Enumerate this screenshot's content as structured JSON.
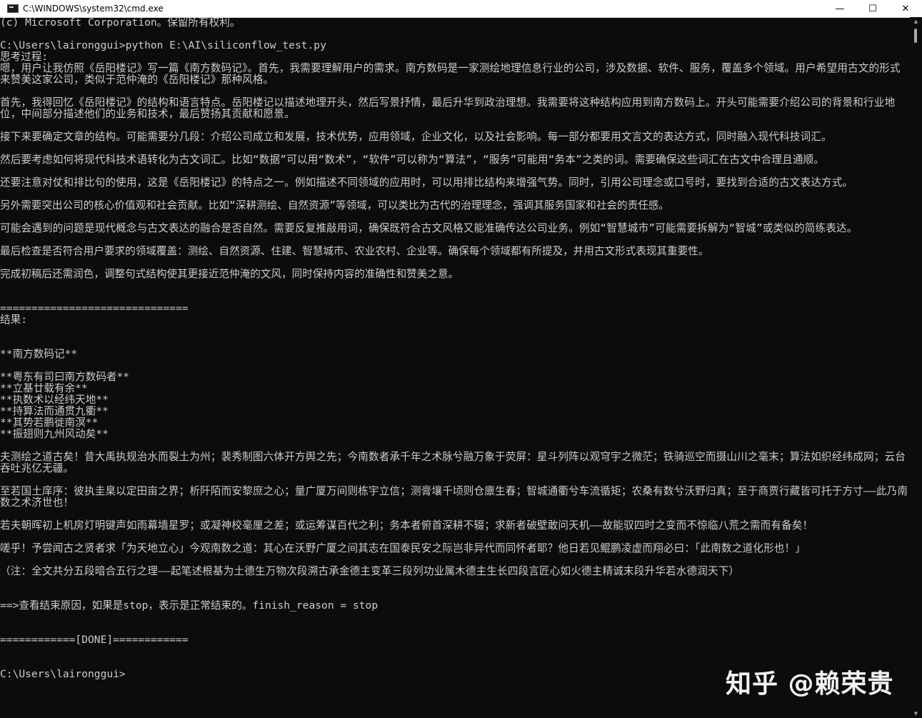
{
  "window": {
    "title": "C:\\WINDOWS\\system32\\cmd.exe",
    "minimize": "—",
    "maximize": "☐",
    "close": "✕"
  },
  "console": {
    "lines": [
      "(c) Microsoft Corporation。保留所有权利。",
      "",
      "C:\\Users\\laironggui>python E:\\AI\\siliconflow_test.py",
      "思考过程:",
      "嗯，用户让我仿照《岳阳楼记》写一篇《南方数码记》。首先，我需要理解用户的需求。南方数码是一家测绘地理信息行业的公司，涉及数据、软件、服务，覆盖多个领域。用户希望用古文的形式来赞美这家公司，类似于范仲淹的《岳阳楼记》那种风格。",
      "",
      "首先，我得回忆《岳阳楼记》的结构和语言特点。岳阳楼记以描述地理开头，然后写景抒情，最后升华到政治理想。我需要将这种结构应用到南方数码上。开头可能需要介绍公司的背景和行业地位，中间部分描述他们的业务和技术，最后赞扬其贡献和愿景。",
      "",
      "接下来要确定文章的结构。可能需要分几段：介绍公司成立和发展，技术优势，应用领域，企业文化，以及社会影响。每一部分都要用文言文的表达方式，同时融入现代科技词汇。",
      "",
      "然后要考虑如何将现代科技术语转化为古文词汇。比如“数据”可以用“数术”，“软件”可以称为“算法”，“服务”可能用“务本”之类的词。需要确保这些词汇在古文中合理且通顺。",
      "",
      "还要注意对仗和排比句的使用，这是《岳阳楼记》的特点之一。例如描述不同领域的应用时，可以用排比结构来增强气势。同时，引用公司理念或口号时，要找到合适的古文表达方式。",
      "",
      "另外需要突出公司的核心价值观和社会贡献。比如“深耕测绘、自然资源”等领域，可以类比为古代的治理理念，强调其服务国家和社会的责任感。",
      "",
      "可能会遇到的问题是现代概念与古文表达的融合是否自然。需要反复推敲用词，确保既符合古文风格又能准确传达公司业务。例如“智慧城市”可能需要拆解为“智城”或类似的简练表达。",
      "",
      "最后检查是否符合用户要求的领域覆盖：测绘、自然资源、住建、智慧城市、农业农村、企业等。确保每个领域都有所提及，并用古文形式表现其重要性。",
      "",
      "完成初稿后还需润色，调整句式结构使其更接近范仲淹的文风，同时保持内容的准确性和赞美之意。",
      "",
      "",
      "==============================",
      "结果:",
      "",
      "",
      "**南方数码记**",
      "",
      "**粤东有司曰南方数码者**",
      "**立基廿载有余**",
      "**执数术以经纬天地**",
      "**持算法而通贯九衢**",
      "**其势若鹏徙南溟**",
      "**振翅则九州风动矣**",
      "",
      "夫测绘之道古矣！昔大禹执规治水而裂土为州；裴秀制图六体开方舆之先；今南数者承千年之术脉兮融万象于荧屏：星斗列阵以观穹宇之微茫；铁骑巡空而摄山川之毫末；算法如织经纬成网；云台吞吐兆亿无疆。",
      "",
      "至若国土庠序：彼执圭臬以定田亩之界；析阡陌而安黎庶之心；量广厦万间则栋宇立信；测膏壤千顷则仓廪生春；智城通衢兮车流循矩；农桑有数兮沃野归真；至于商贾行藏皆可托于方寸——此乃南数之术济世也！",
      "",
      "若夫朝晖初上机房灯明键声如雨幕墙星罗；或凝神校毫厘之差；或运筹谋百代之利；务本者俯首深耕不辍；求新者破壁敢问天机——故能驭四时之变而不惊临八荒之需而有备矣！",
      "",
      "嗟乎！予尝闻古之贤者求「为天地立心」今观南数之道：其心在沃野广厦之间其志在国泰民安之际岂非异代而同怀者耶？他日若见鲲鹏凌虚而翔必曰：「此南数之道化形也！」",
      "",
      "（注：全文共分五段暗合五行之理——起笔述根基为土德生万物次段溯古承金德主变革三段列功业属木德主生长四段言匠心如火德主精诚末段升华若水德润天下）",
      "",
      "",
      "==>查看结束原因，如果是stop，表示是正常结束的。finish_reason = stop",
      "",
      "",
      "============[DONE]============",
      "",
      "",
      "C:\\Users\\laironggui>"
    ]
  },
  "watermark": "知乎 @赖荣贵",
  "colors": {
    "background": "#0c0c0c",
    "text": "#cccccc",
    "titlebar": "#ffffff"
  }
}
